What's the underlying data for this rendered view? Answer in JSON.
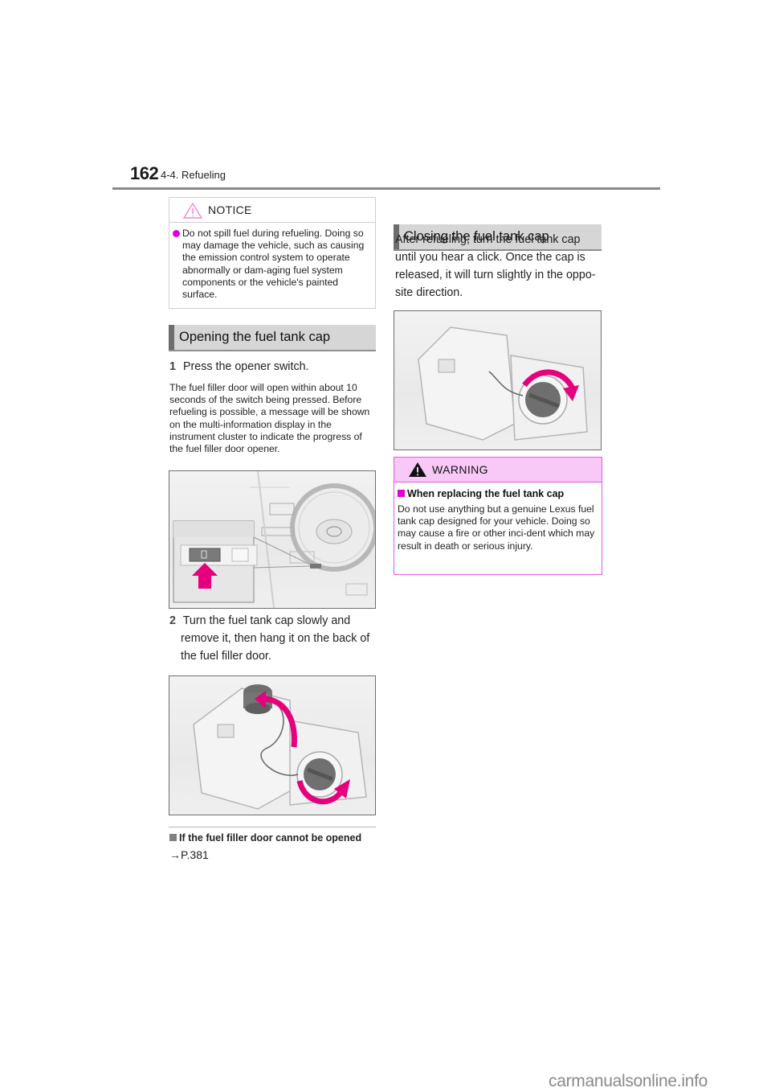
{
  "header": {
    "page_number": "162",
    "section": "4-4. Refueling"
  },
  "notice": {
    "label": "NOTICE",
    "icon": "caution-triangle-outline-icon",
    "bullet": "Do not spill fuel during refueling. Doing so may damage the vehicle, such as causing the emission control system to operate abnormally or dam-aging fuel system components or the vehicle's painted surface."
  },
  "opening": {
    "heading": "Opening the fuel tank cap",
    "step1": {
      "number": "1",
      "text": "Press the opener switch."
    },
    "step1_description": "The fuel filler door will open within about 10 seconds of the switch being pressed. Before refueling is possible, a message will be shown on the multi-information display in the instrument cluster to indicate the progress of the fuel filler door opener.",
    "figure1": "Fuel filler door opener switch location on the dashboard, with arrow pointing to the switch",
    "step2": {
      "number": "2",
      "text_line1": "Turn the fuel tank cap slowly and",
      "text_rest": "remove it, then hang it on the back of the fuel filler door."
    },
    "figure2": "Fuel tank cap being turned and hung on the back of the fuel filler door",
    "note_heading": "If the fuel filler door cannot be opened",
    "note_reference": "→P.381"
  },
  "closing": {
    "heading": "Closing the fuel tank cap",
    "text": "After refueling, turn the fuel tank cap until you hear a click. Once the cap is released, it will turn slightly in the oppo-site direction.",
    "figure3": "Fuel tank cap being turned clockwise to close"
  },
  "warning": {
    "label": "WARNING",
    "icon": "warning-triangle-filled-icon",
    "subheading": "When replacing the fuel tank cap",
    "text": "Do not use anything but a genuine Lexus fuel tank cap designed for your vehicle. Doing so may cause a fire or other inci-dent which may result in death or serious injury."
  },
  "colors": {
    "accent_magenta": "#e000d8",
    "warning_header_bg": "#f8c8f6",
    "section_heading_bg": "#d6d6d6"
  },
  "watermark": "carmanualsonline.info"
}
